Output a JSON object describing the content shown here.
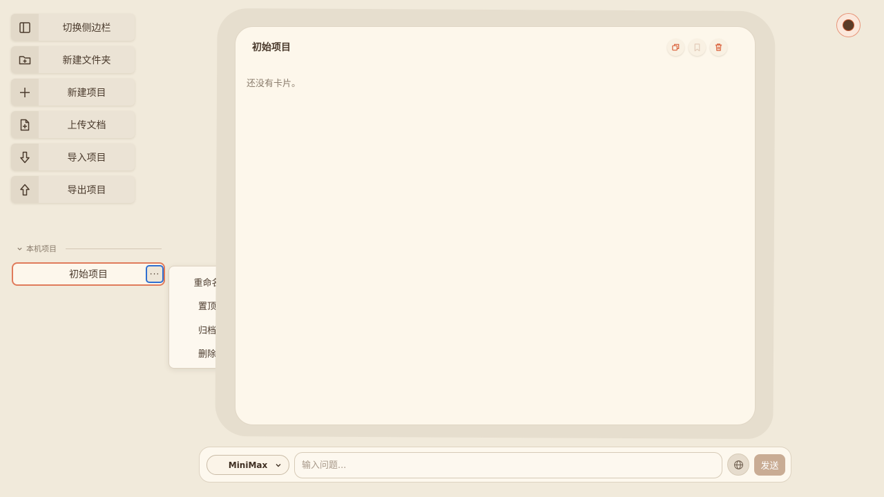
{
  "toolbar": {
    "items": [
      {
        "label": "切换侧边栏",
        "icon": "sidebar-toggle-icon"
      },
      {
        "label": "新建文件夹",
        "icon": "folder-plus-icon"
      },
      {
        "label": "新建项目",
        "icon": "plus-icon"
      },
      {
        "label": "上传文档",
        "icon": "file-plus-icon"
      },
      {
        "label": "导入项目",
        "icon": "arrow-down-icon"
      },
      {
        "label": "导出项目",
        "icon": "arrow-up-icon"
      }
    ]
  },
  "sidebar": {
    "section_title": "本机项目",
    "projects": [
      {
        "name": "初始项目",
        "more_label": "···"
      }
    ]
  },
  "context_menu": {
    "items": [
      "重命名",
      "置顶",
      "归档",
      "删除"
    ]
  },
  "main": {
    "title": "初始项目",
    "empty_message": "还没有卡片。",
    "actions": [
      "duplicate-icon",
      "bookmark-icon",
      "trash-icon"
    ]
  },
  "input_bar": {
    "model": "MiniMax",
    "placeholder": "输入问题...",
    "send_label": "发送"
  },
  "colors": {
    "background": "#f1eadb",
    "accent": "#e07a5a",
    "focus": "#2f6fd0",
    "send": "#c9ac94",
    "text": "#4a3a2c"
  }
}
